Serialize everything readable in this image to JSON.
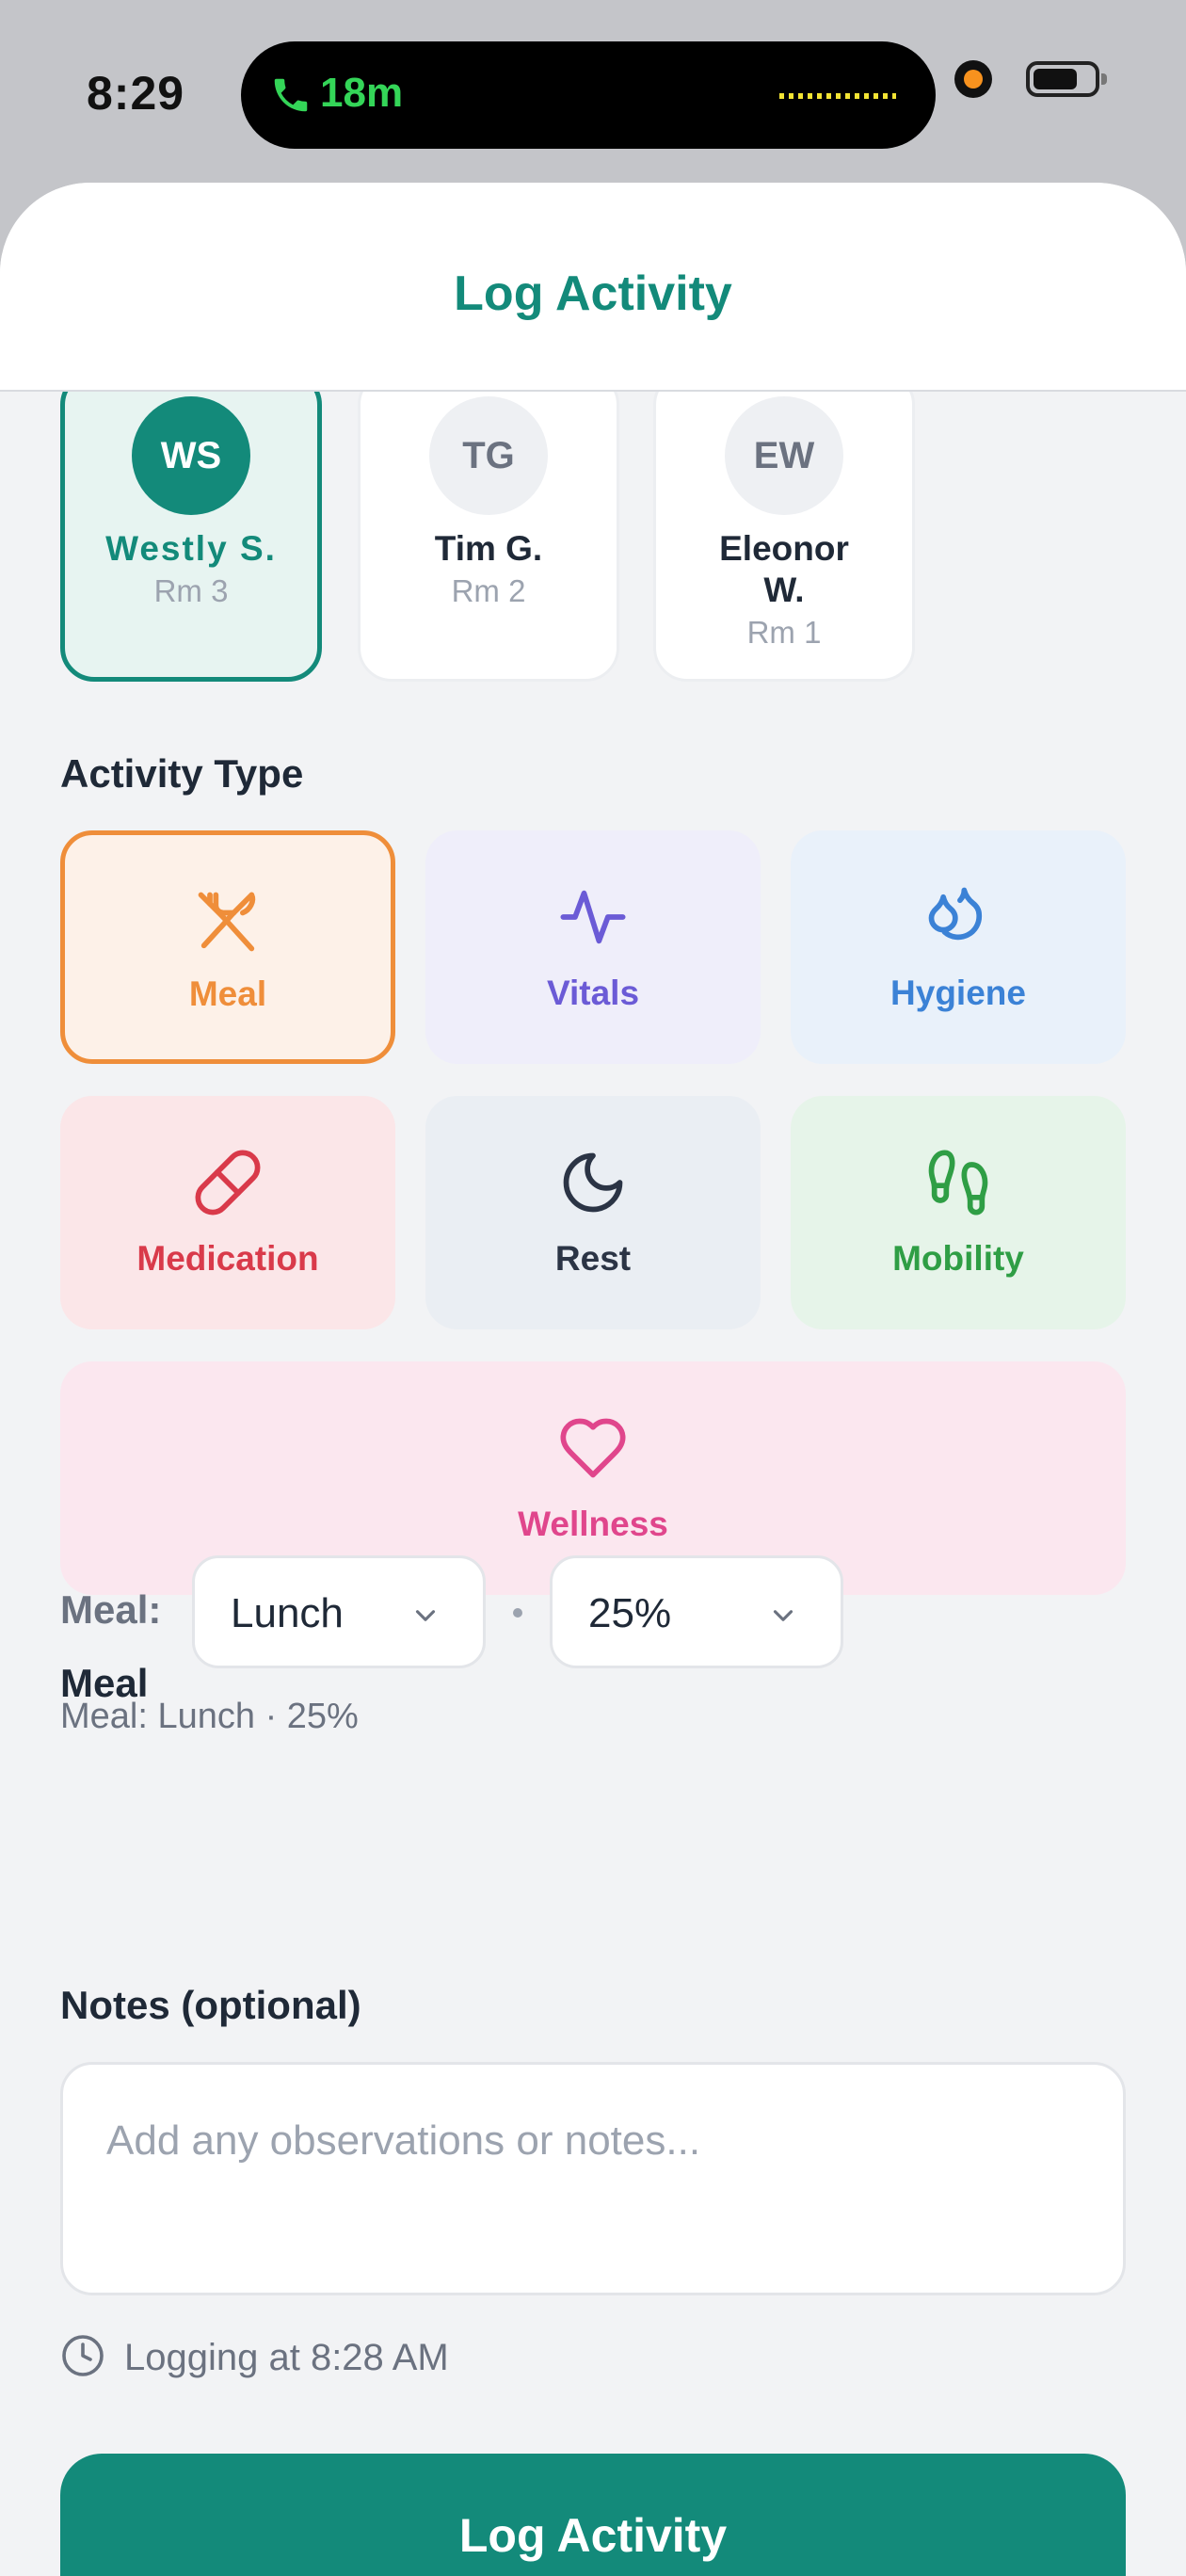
{
  "status_bar": {
    "time": "8:29",
    "call_duration": "18m"
  },
  "header": {
    "title": "Log Activity"
  },
  "residents": [
    {
      "initials": "WS",
      "name": "Westly  S.",
      "room": "Rm 3",
      "selected": true
    },
    {
      "initials": "TG",
      "name": "Tim G.",
      "room": "Rm 2",
      "selected": false
    },
    {
      "initials": "EW",
      "name": "Eleonor W.",
      "room": "Rm 1",
      "selected": false
    }
  ],
  "activity_section": {
    "label": "Activity Type",
    "types": [
      {
        "label": "Meal",
        "icon": "fork-knife-icon",
        "color": "#ef8e3a",
        "background": "#fdf1e8",
        "selected": true
      },
      {
        "label": "Vitals",
        "icon": "pulse-icon",
        "color": "#6b5bd6",
        "background": "#efeefa",
        "selected": false
      },
      {
        "label": "Hygiene",
        "icon": "droplets-icon",
        "color": "#3b82d6",
        "background": "#e9f1fa",
        "selected": false
      },
      {
        "label": "Medication",
        "icon": "pill-icon",
        "color": "#d93a4a",
        "background": "#fbe6e8",
        "selected": false
      },
      {
        "label": "Rest",
        "icon": "moon-icon",
        "color": "#2b3445",
        "background": "#eaeef3",
        "selected": false
      },
      {
        "label": "Mobility",
        "icon": "footprints-icon",
        "color": "#2f9e45",
        "background": "#e6f4e9",
        "selected": false
      },
      {
        "label": "Wellness",
        "icon": "heart-icon",
        "color": "#e0468c",
        "background": "#fbe7ef",
        "selected": false
      }
    ]
  },
  "meal_section": {
    "label": "Meal",
    "prefix": "Meal:",
    "meal_select": "Lunch",
    "portion_select": "25%",
    "summary": "Meal: Lunch · 25%"
  },
  "notes_section": {
    "label": "Notes (optional)",
    "placeholder": "Add any observations or notes..."
  },
  "logging_at": "Logging at 8:28 AM",
  "submit_label": "Log Activity"
}
